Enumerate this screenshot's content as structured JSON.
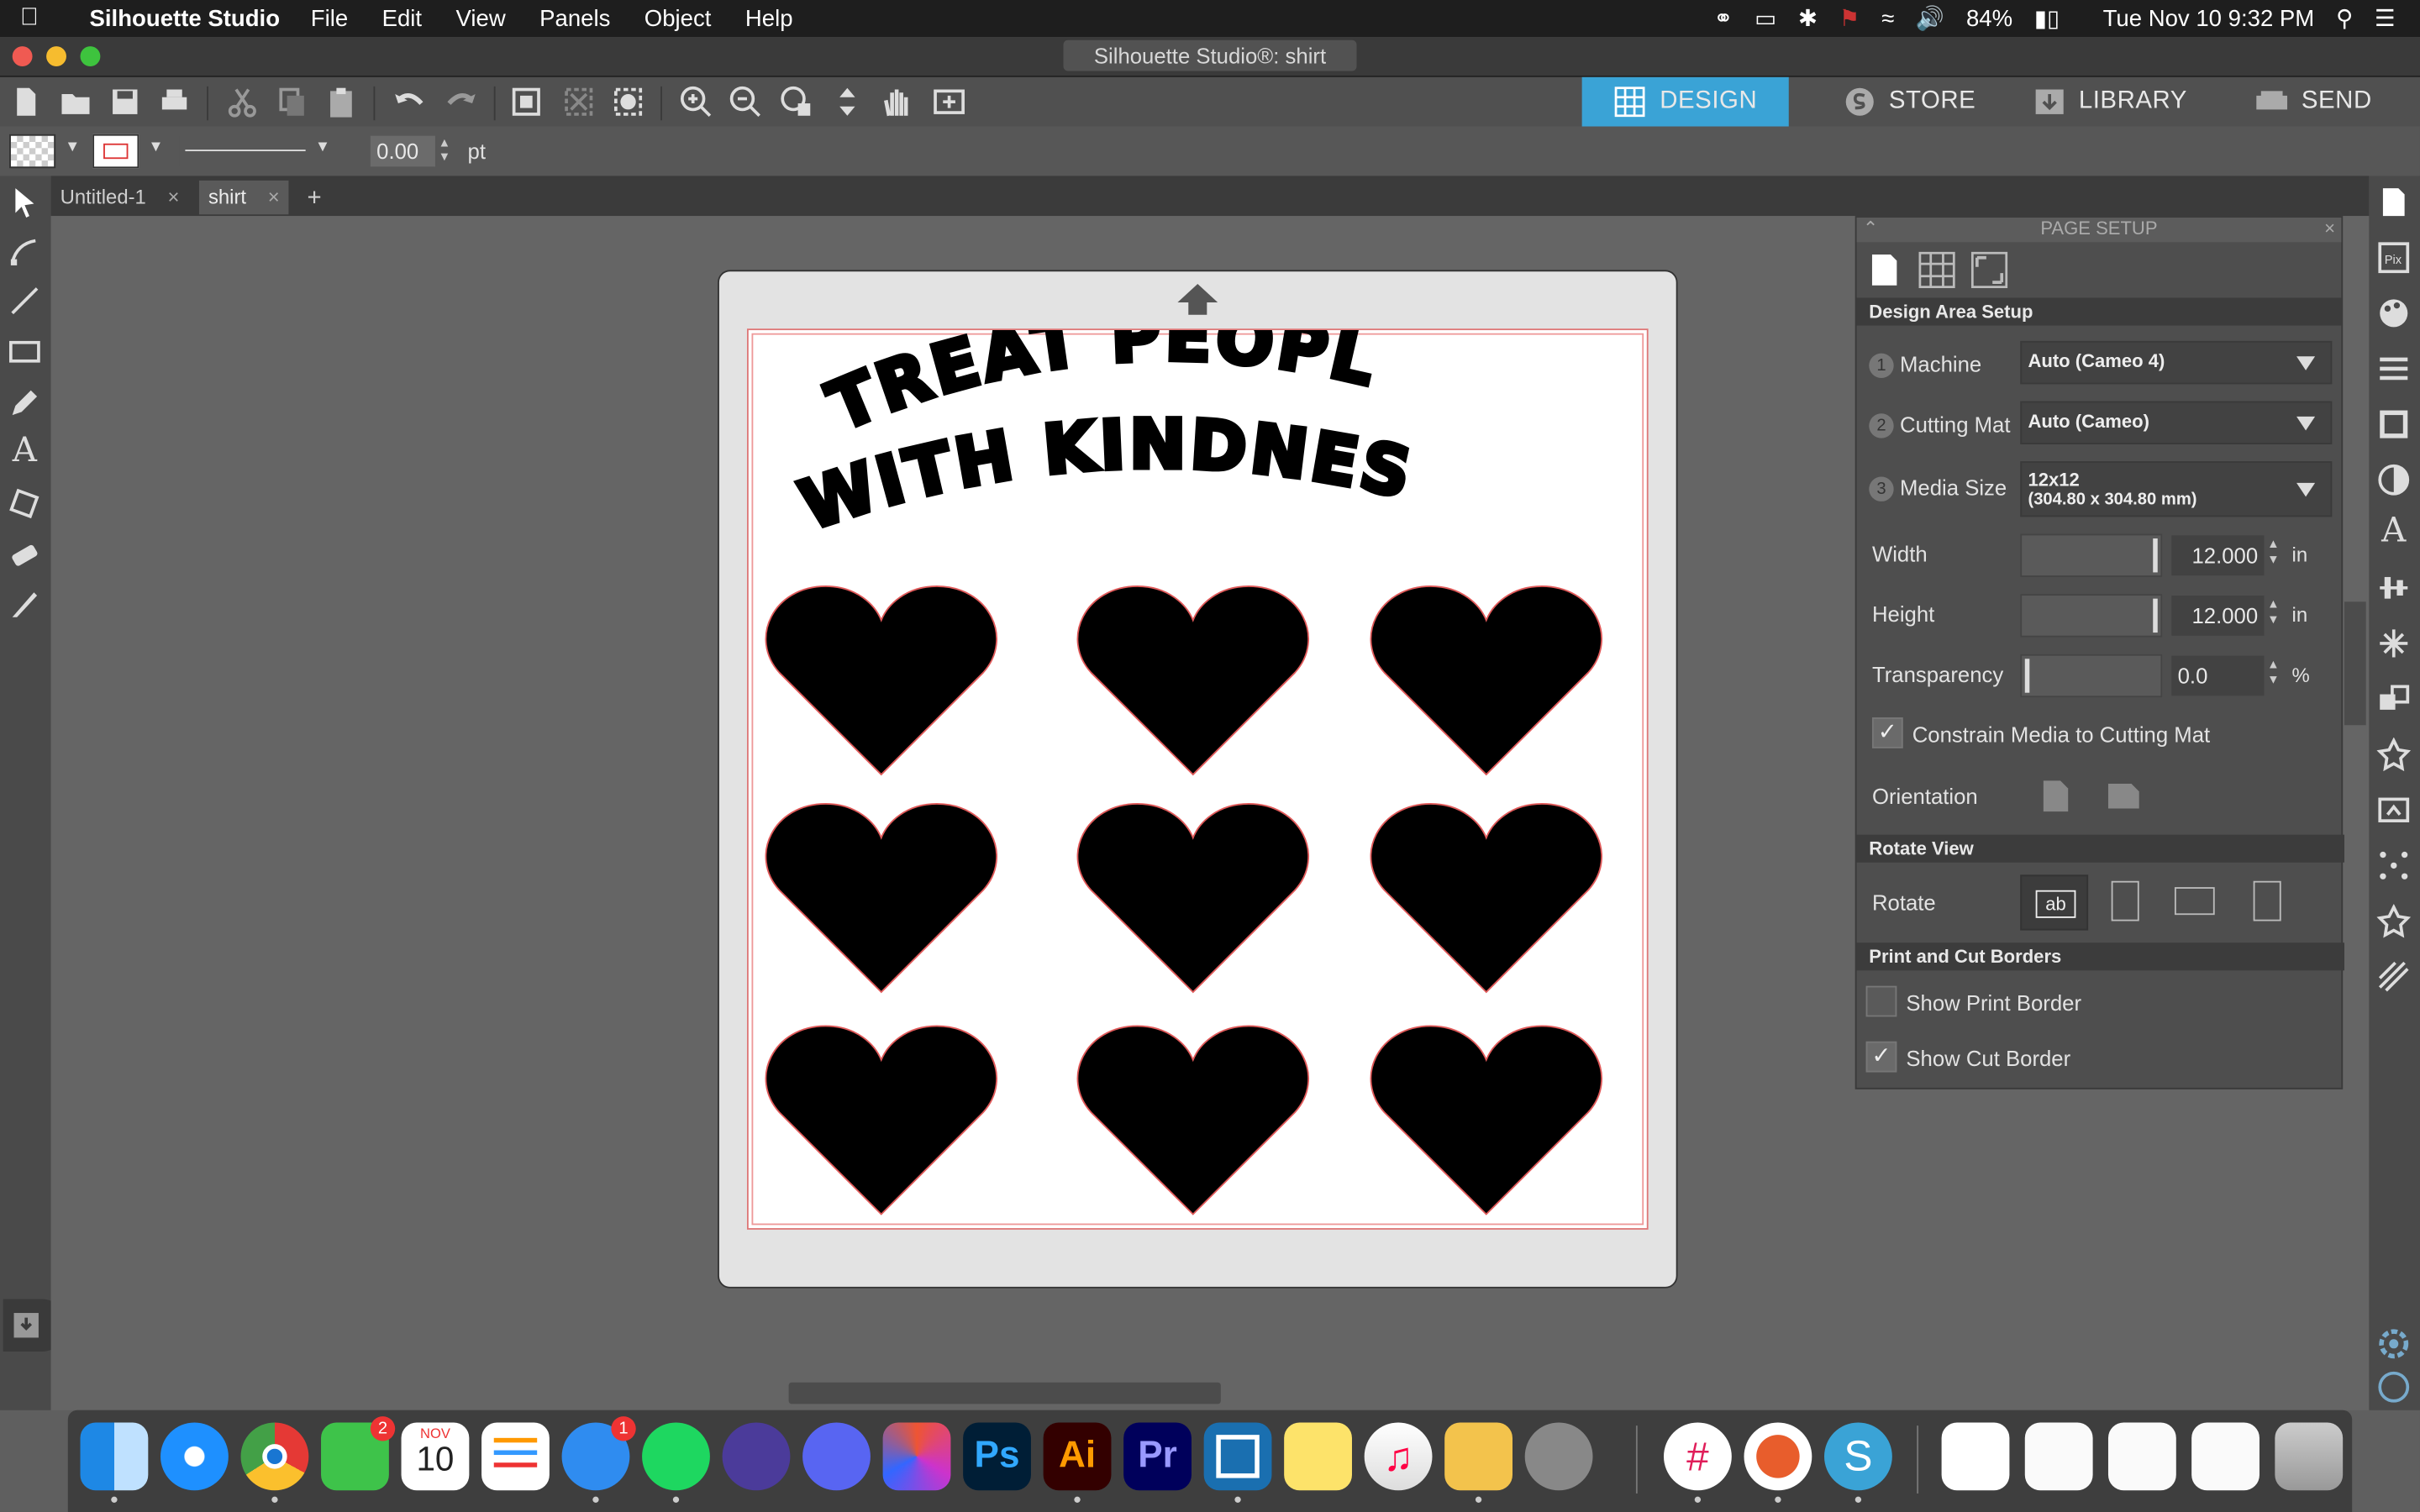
{
  "menubar": {
    "app_name": "Silhouette Studio",
    "items": [
      "File",
      "Edit",
      "View",
      "Panels",
      "Object",
      "Help"
    ],
    "battery": "84%",
    "datetime": "Tue Nov 10  9:32 PM"
  },
  "window": {
    "title": "Silhouette Studio®: shirt"
  },
  "topnav": {
    "design": "DESIGN",
    "store": "STORE",
    "library": "LIBRARY",
    "send": "SEND"
  },
  "stylebar": {
    "line_width": "0.00",
    "unit": "pt"
  },
  "tabs": [
    {
      "label": "Untitled-1"
    },
    {
      "label": "shirt"
    }
  ],
  "design": {
    "text_line1": "TREAT PEOPLE",
    "text_line2": "WITH KINDNESS",
    "heart_count": 9
  },
  "panel": {
    "title": "PAGE SETUP",
    "design_area_setup": "Design Area Setup",
    "machine": {
      "num": "1",
      "label": "Machine",
      "value": "Auto (Cameo 4)"
    },
    "cutting_mat": {
      "num": "2",
      "label": "Cutting Mat",
      "value": "Auto (Cameo)"
    },
    "media_size": {
      "num": "3",
      "label": "Media Size",
      "value": "12x12",
      "sub": "(304.80 x 304.80 mm)"
    },
    "width": {
      "label": "Width",
      "value": "12.000",
      "unit": "in"
    },
    "height": {
      "label": "Height",
      "value": "12.000",
      "unit": "in"
    },
    "transparency": {
      "label": "Transparency",
      "value": "0.0",
      "unit": "%"
    },
    "constrain": {
      "label": "Constrain Media to Cutting Mat",
      "checked": true
    },
    "orientation": "Orientation",
    "rotate_view": "Rotate View",
    "rotate": "Rotate",
    "print_cut_borders": "Print and Cut Borders",
    "show_print_border": {
      "label": "Show Print Border",
      "checked": false
    },
    "show_cut_border": {
      "label": "Show Cut Border",
      "checked": true
    }
  },
  "dock": {
    "facetime_badge": "2",
    "messages_badge": "1",
    "calendar_month": "NOV",
    "calendar_day": "10",
    "app_labels": {
      "ps": "Ps",
      "ai": "Ai",
      "pr": "Pr"
    }
  },
  "colors": {
    "accent_blue": "#3aa3d6",
    "cut_line": "#e05a5a",
    "panel_bg": "#4e4e4e"
  }
}
